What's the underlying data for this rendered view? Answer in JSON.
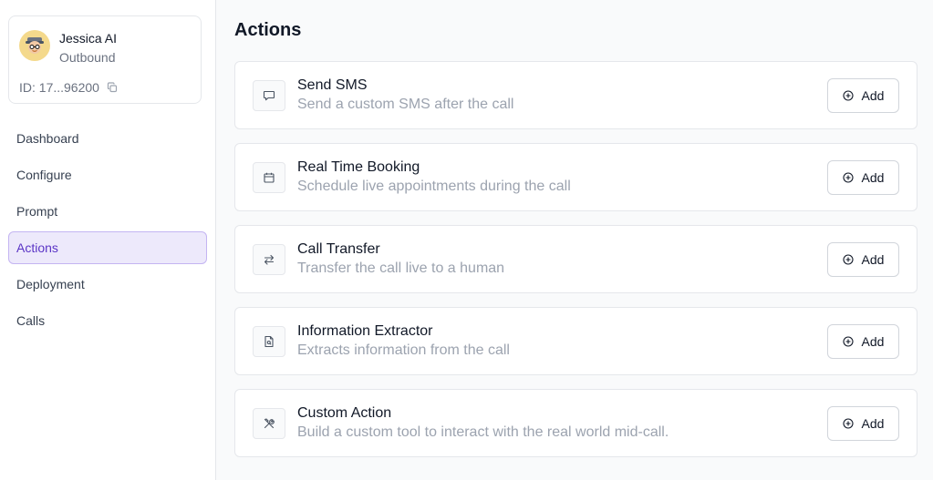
{
  "agent": {
    "name": "Jessica AI",
    "type": "Outbound",
    "id_label": "ID: 17...96200",
    "avatar_icon": "woman-avatar-icon"
  },
  "nav": {
    "items": [
      {
        "label": "Dashboard",
        "active": false
      },
      {
        "label": "Configure",
        "active": false
      },
      {
        "label": "Prompt",
        "active": false
      },
      {
        "label": "Actions",
        "active": true
      },
      {
        "label": "Deployment",
        "active": false
      },
      {
        "label": "Calls",
        "active": false
      }
    ]
  },
  "main": {
    "title": "Actions",
    "add_label": "Add",
    "actions": [
      {
        "title": "Send SMS",
        "description": "Send a custom SMS after the call",
        "icon": "message-icon"
      },
      {
        "title": "Real Time Booking",
        "description": "Schedule live appointments during the call",
        "icon": "calendar-icon"
      },
      {
        "title": "Call Transfer",
        "description": "Transfer the call live to a human",
        "icon": "transfer-arrows-icon"
      },
      {
        "title": "Information Extractor",
        "description": "Extracts information from the call",
        "icon": "document-search-icon"
      },
      {
        "title": "Custom Action",
        "description": "Build a custom tool to interact with the real world mid-call.",
        "icon": "tools-icon"
      }
    ]
  },
  "colors": {
    "accent": "#5b35c6",
    "active_bg": "#ede9fb",
    "active_border": "#c4b5f2",
    "muted_text": "#9ca3af"
  }
}
